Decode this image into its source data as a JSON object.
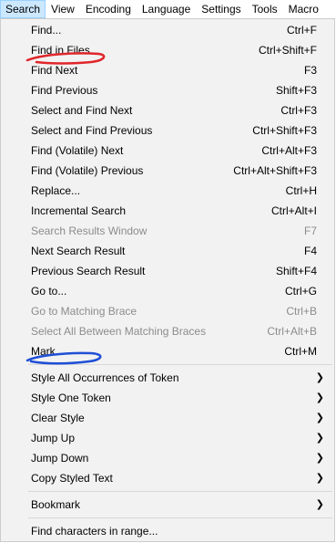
{
  "menubar": {
    "items": [
      "Search",
      "View",
      "Encoding",
      "Language",
      "Settings",
      "Tools",
      "Macro"
    ],
    "active": "Search"
  },
  "menu": {
    "items": [
      {
        "label": "Find...",
        "shortcut": "Ctrl+F"
      },
      {
        "label": "Find in Files...",
        "shortcut": "Ctrl+Shift+F"
      },
      {
        "label": "Find Next",
        "shortcut": "F3"
      },
      {
        "label": "Find Previous",
        "shortcut": "Shift+F3"
      },
      {
        "label": "Select and Find Next",
        "shortcut": "Ctrl+F3"
      },
      {
        "label": "Select and Find Previous",
        "shortcut": "Ctrl+Shift+F3"
      },
      {
        "label": "Find (Volatile) Next",
        "shortcut": "Ctrl+Alt+F3"
      },
      {
        "label": "Find (Volatile) Previous",
        "shortcut": "Ctrl+Alt+Shift+F3"
      },
      {
        "label": "Replace...",
        "shortcut": "Ctrl+H"
      },
      {
        "label": "Incremental Search",
        "shortcut": "Ctrl+Alt+I"
      },
      {
        "label": "Search Results Window",
        "shortcut": "F7",
        "disabled": true
      },
      {
        "label": "Next Search Result",
        "shortcut": "F4"
      },
      {
        "label": "Previous Search Result",
        "shortcut": "Shift+F4"
      },
      {
        "label": "Go to...",
        "shortcut": "Ctrl+G"
      },
      {
        "label": "Go to Matching Brace",
        "shortcut": "Ctrl+B",
        "disabled": true
      },
      {
        "label": "Select All Between Matching Braces",
        "shortcut": "Ctrl+Alt+B",
        "disabled": true
      },
      {
        "label": "Mark...",
        "shortcut": "Ctrl+M"
      }
    ],
    "submenus": [
      {
        "label": "Style All Occurrences of Token"
      },
      {
        "label": "Style One Token"
      },
      {
        "label": "Clear Style"
      },
      {
        "label": "Jump Up"
      },
      {
        "label": "Jump Down"
      },
      {
        "label": "Copy Styled Text"
      }
    ],
    "bookmark": {
      "label": "Bookmark"
    },
    "find_chars": {
      "label": "Find characters in range..."
    }
  },
  "annotations": {
    "red_stroke_color": "#e0262b",
    "blue_stroke_color": "#1f4fd6"
  }
}
